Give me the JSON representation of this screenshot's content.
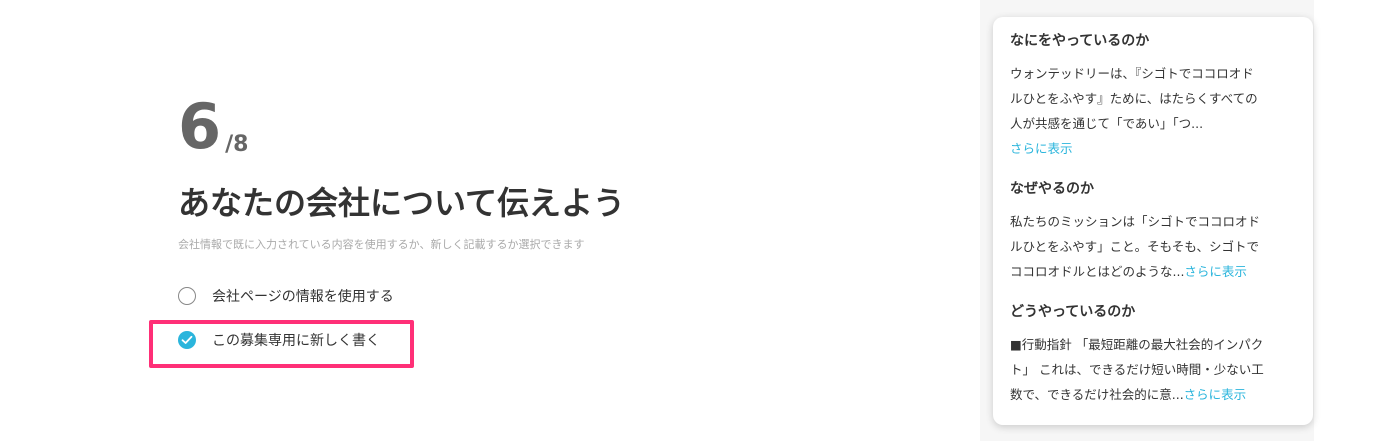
{
  "step": {
    "current": "6",
    "total": "/8"
  },
  "main": {
    "title": "あなたの会社について伝えよう",
    "description": "会社情報で既に入力されている内容を使用するか、新しく記載するか選択できます",
    "options": [
      {
        "label": "会社ページの情報を使用する",
        "selected": false
      },
      {
        "label": "この募集専用に新しく書く",
        "selected": true
      }
    ]
  },
  "info_card": {
    "sections": [
      {
        "heading": "なにをやっているのか",
        "lines": [
          "ウォンテッドリーは、『シゴトでココロオド",
          "ルひとをふやす』ために、はたらくすべての",
          "人が共感を通じて「であい」「つ..."
        ],
        "more_label": "さらに表示"
      },
      {
        "heading": "なぜやるのか",
        "lines": [
          "私たちのミッションは「シゴトでココロオド",
          "ルひとをふやす」こと。そもそも、シゴトで",
          "ココロオドルとはどのような..."
        ],
        "more_label": "さらに表示"
      },
      {
        "heading": "どうやっているのか",
        "lines": [
          "■行動指針 「最短距離の最大社会的インパク",
          "ト」 これは、できるだけ短い時間・少ない工",
          "数で、できるだけ社会的に意..."
        ],
        "more_label": "さらに表示"
      }
    ]
  },
  "colors": {
    "accent": "#2bb5dc",
    "highlight": "#ff2f77"
  }
}
